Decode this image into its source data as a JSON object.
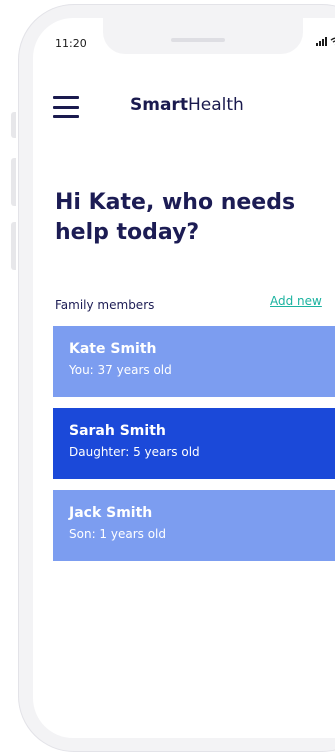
{
  "status_bar": {
    "time": "11:20"
  },
  "header": {
    "menu_icon": "hamburger-menu-icon",
    "logo_bold": "Smart",
    "logo_regular": "Health"
  },
  "greeting": "Hi Kate, who needs help today?",
  "family": {
    "label": "Family members",
    "add_link": "Add new",
    "members": [
      {
        "name": "Kate Smith",
        "relation": "You: 37 years old",
        "selected": false,
        "chevron": ">"
      },
      {
        "name": "Sarah Smith",
        "relation": "Daughter: 5 years old",
        "selected": true,
        "chevron": ">"
      },
      {
        "name": "Jack Smith",
        "relation": "Son: 1 years old",
        "selected": false,
        "chevron": ">"
      }
    ]
  },
  "colors": {
    "card_default": "#7c9df0",
    "card_selected": "#1b49d9",
    "link": "#1bb3a0",
    "heading": "#1c1c54"
  }
}
